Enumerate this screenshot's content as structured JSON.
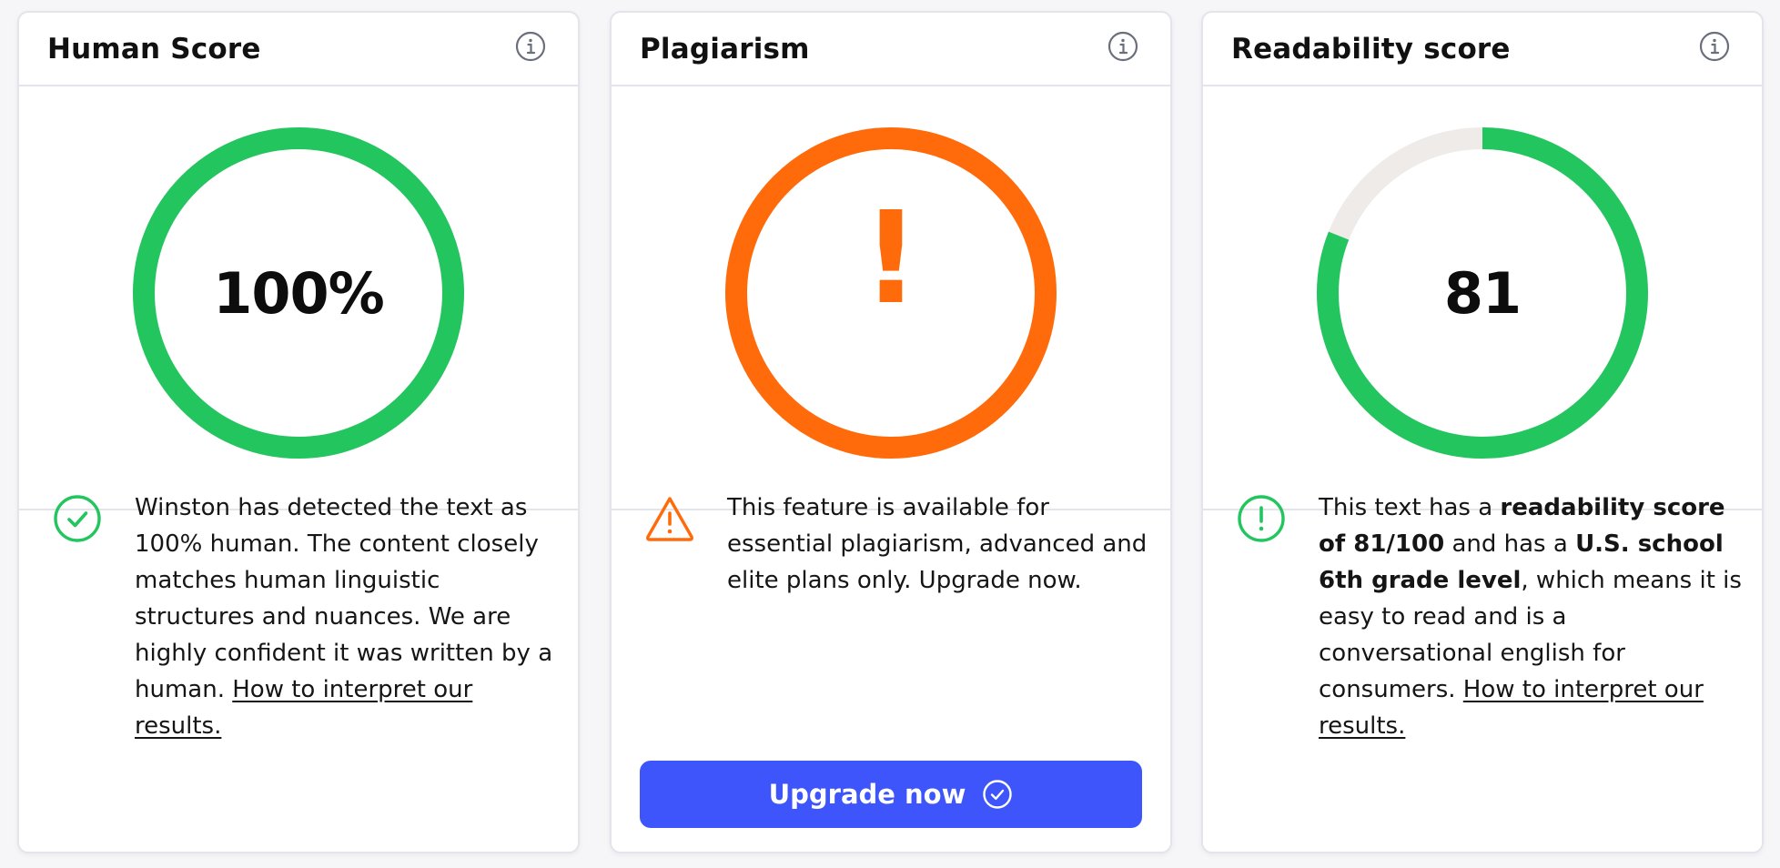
{
  "colors": {
    "green": "#22c55e",
    "orange": "#ff6a0a",
    "blue": "#3d55fb",
    "track": "#eeebe9"
  },
  "human_card": {
    "title": "Human Score",
    "score_display": "100%",
    "score_fraction": 1.0,
    "description": "Winston has detected the text as 100% human. The content closely matches human linguistic structures and nuances. We are highly confident it was written by a human.",
    "link_text": "How to interpret our results.",
    "status_icon": "check-circle-icon"
  },
  "plagiarism_card": {
    "title": "Plagiarism",
    "symbol": "!",
    "description": "This feature is available for essential plagiarism, advanced and elite plans only. Upgrade now.",
    "button_label": "Upgrade now",
    "status_icon": "warning-triangle-icon"
  },
  "readability_card": {
    "title": "Readability score",
    "score_display": "81",
    "score_fraction": 0.81,
    "desc_part1": "This text has a ",
    "desc_bold1": "readability score of 81/100",
    "desc_part2": " and has a ",
    "desc_bold2": "U.S. school 6th grade level",
    "desc_part3": ", which means it is easy to read and is a conversational english for consumers.",
    "link_text": "How to interpret our results.",
    "status_icon": "exclamation-circle-icon"
  }
}
